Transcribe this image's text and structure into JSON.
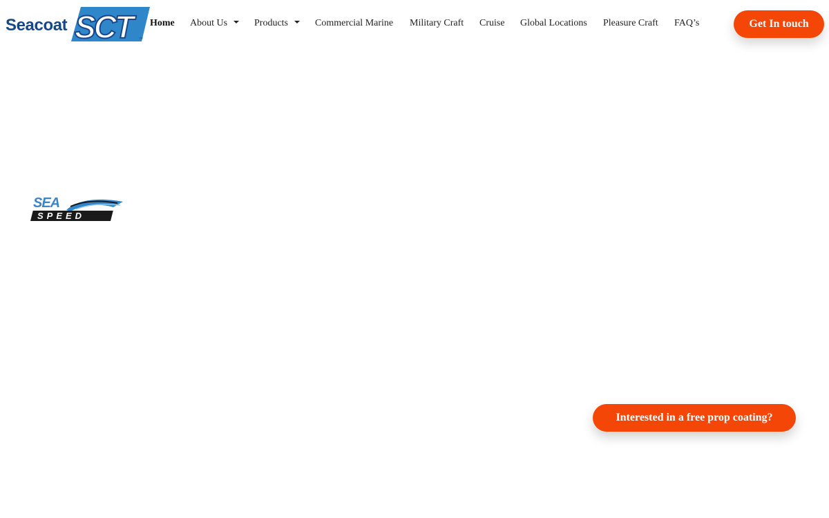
{
  "brand": {
    "wordmark": "Seacoat",
    "mark_letters": "SCT",
    "trademark": "™",
    "colors": {
      "navy": "#17468a",
      "blue": "#2f86c8"
    }
  },
  "nav": {
    "items": [
      {
        "label": "Home",
        "active": true,
        "dropdown": false
      },
      {
        "label": "About Us",
        "active": false,
        "dropdown": true
      },
      {
        "label": "Products",
        "active": false,
        "dropdown": true
      },
      {
        "label": "Commercial Marine",
        "active": false,
        "dropdown": false
      },
      {
        "label": "Military Craft",
        "active": false,
        "dropdown": false
      },
      {
        "label": "Cruise",
        "active": false,
        "dropdown": false
      },
      {
        "label": "Global Locations",
        "active": false,
        "dropdown": false
      },
      {
        "label": "Pleasure Craft",
        "active": false,
        "dropdown": false
      },
      {
        "label": "FAQ’s",
        "active": false,
        "dropdown": false
      }
    ]
  },
  "header": {
    "cta_label": "Get In touch"
  },
  "content": {
    "sea_speed_logo": {
      "line1": "SEA",
      "line2": "SPEED"
    }
  },
  "floating": {
    "prop_coating_label": "Interested in a free prop coating?"
  },
  "colors": {
    "accent": "#f34607",
    "text": "#222222"
  }
}
